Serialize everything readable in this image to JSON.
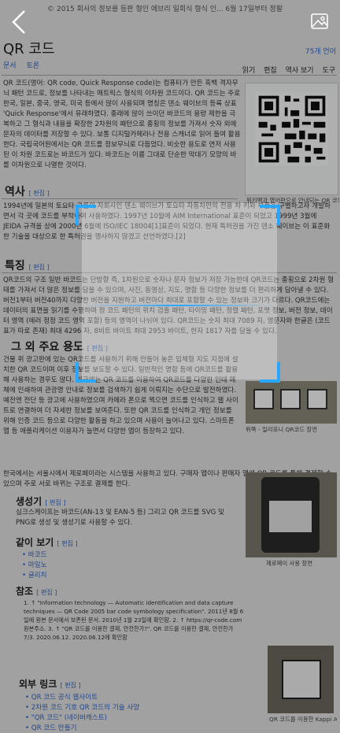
{
  "page": {
    "top_note": "© 2015 회사의 정보를 등판 형인 에브리 일회식 형식 인... 6월 17일부터 정팔정었다.",
    "title": "QR 코드",
    "lang_label": "75개 언어",
    "tabs": [
      "문서",
      "토론"
    ],
    "page_tabs": [
      "읽기",
      "편집",
      "역사 보기",
      "도구"
    ],
    "intro": "QR 코드(영어: QR code, Quick Response code)는 컴퓨터가 만든 흑백 격자무늬 패턴 코드로, 정보를 나타내는 매트릭스 형식의 이차원 코드이다. QR 코드는 주로 한국, 일본, 중국, 영국, 미국 등에서 많이 사용되며 명칭은 덴소 웨이브의 등록 상표 'Quick Response'에서 유래하였다. 종래에 많이 쓰이던 바코드의 용량 제한을 극복하고 그 형식과 내용을 확장한 2차원의 패턴으로 종횡의 정보를 가져서 숫자 외에 문자의 데이터를 저장할 수 있다. 보통 디지털카메라나 전용 스캐너로 읽어 들여 활용한다. 국립국어원에서는 QR 코드를 정보무늬로 다듬었다. 비슷한 용도로 연저 사용된 이 차원 코드로는 바코드가 있다. 바코드는 이름 그대로 단순한 막대기 모양의 바를 이차원으로 나열한 것이다.",
    "infobox_caption": "위키백과 영어판으로 안내되는 QR 코드",
    "history_heading": "역사",
    "edit_label": "[ 편집 ]",
    "history": "1994년에 일본의 토요타 그룹의 자회사인 덴소 웨이브가 토요타 자동차만의 전용 차 키와 부품을 구별하고자 개발하면서 각 곳에 코드를 부착하여 사용하였다. 1997년 10월에 AIM International 표준이 되었고 1999년 3월에 JEIDA 규격을 상에 2000년 6월에 ISO/IEC 18004[1]표준이 되었다. 현재 특허권을 가진 덴소 웨이브는 이 표준화한 기술을 대상으로 한 특허권을 행사하지 않겠고 선언하였다.[2]",
    "feature_heading": "특징",
    "feature": "QR코드의 구조 일반 바코드는 단방향 즉, 1차원으로 숫자나 문자 정보가 저장 가능한데 QR코드는 종횡으로 2차원 형태를 가져서 더 많은 정보를 담을 수 있으며, 사진, 동영상, 지도, 명함 등 다양한 정보를 더 편리하게 담아낼 수 있다. 버전1부터 버전40까지 다양한 버전을 지원하고 버전마다 최대로 포함할 수 있는 정보와 크기가 다르다. QR코드에는 데이터의 표면을 읽기를 수행하며 정 코드 패턴의 위치 검출 패턴, 타이밍 패턴, 정렬 패턴, 포맷 정보, 버전 정보, 데이터 영역 (에러 정정 코드 영역 포함) 등의 영역이 나뉘어 있다. QR코드는 숫자 최대 7089 자, 영문자와 한글은 (코드표가 따로 존재) 최대 4296 자, 8비트 바이트 최대 2953 바이트, 한자 1817 자를 담을 수 있다.",
    "other_heading": "그 외 주요 용도",
    "other": "건물 위 광고판에 있는 QR코드를 사용하기 위해 만들어 놓은 입체형 지도 지점에 설치한 QR 코드이며 이후 정보를 보도할 수 있다. 일반적인 명함 등에 QR코드를 활용해 사용하는 경우도 많다. 최근에는 QR 코드를 이용하여 QR코드를 다양한 인테 매체에 인쇄하여 관광명 안내로 정보를 검색하기 쉽게 이뤄지는 수단으로 발전하였다. 예전엔 전단 등 광고에 사용하였으며 카메라 폰으로 찍으면 코드를 인식하고 웹 사이트로 연결하여 더 자세한 정보를 보여준다. 또한 QR 코드를 인식하고 개인 정보를 위해 인증 코드 등으로 다양한 활동을 하고 있으며 사용이 늘어나고 있다. 스마트폰 앱 등 애플리케이션 이용자가 늘면서 다양한 앱이 등장하고 있다.",
    "other2": "한국에서는 서울시에서 제로페이라는 시스템을 사용하고 있다. 구매자 앱이나 판매자 앱에 QR 코드를 통해 결제할 수 있으며 주로 서로 바뀌는 구조로 결제를 한다.",
    "gen_heading": "생성기",
    "gen": "심크스케이프는 바코드(AN-13 및 EAN-5 등) 그리고 QR 코드를 SVG 및 PNG로 생성 및 생성기로 사용할 수 있다.",
    "see_heading": "같이 보기",
    "see_items": [
      "• 바코드",
      "• 마일노",
      "• 글리치"
    ],
    "ref_heading": "참조",
    "refs": "1. ↑ \"Information technology — Automatic identification and data capture techniques — QR Code 2005 bar code symbology specification\". 2011년 8월 6일에 원본 문서에서 보존된 문서. 2010년 1월 23일에 확인함. 2. ↑ https://qr-code.com 원본주소. 3. ↑ \"QR 코드를 이용한 결제, 안전한가?\". QR 코드를 이용한 결제, 안전한가 7/3. 2020.06.12. 2020.06.12에 확인함",
    "ext_heading": "외부 링크",
    "ext_items": [
      "• QR 코드 공식 웹사이트",
      "• 2차원 코드 기호 QR 코드의 기술 사양",
      "• \"QR 코드\" (네이버캐스트)",
      "• QR 코드 만들기"
    ],
    "caption_photo1": "위쪽 - 일리포니 QR코드 장면",
    "caption_photo2": "제로페이 사용 장면",
    "caption_photo3": "QR 코드를 이용한 Kappi Ai"
  },
  "scanner": {
    "back_icon": "chevron-left-icon",
    "gallery_icon": "image-icon",
    "accent_color": "#28a7ff"
  }
}
